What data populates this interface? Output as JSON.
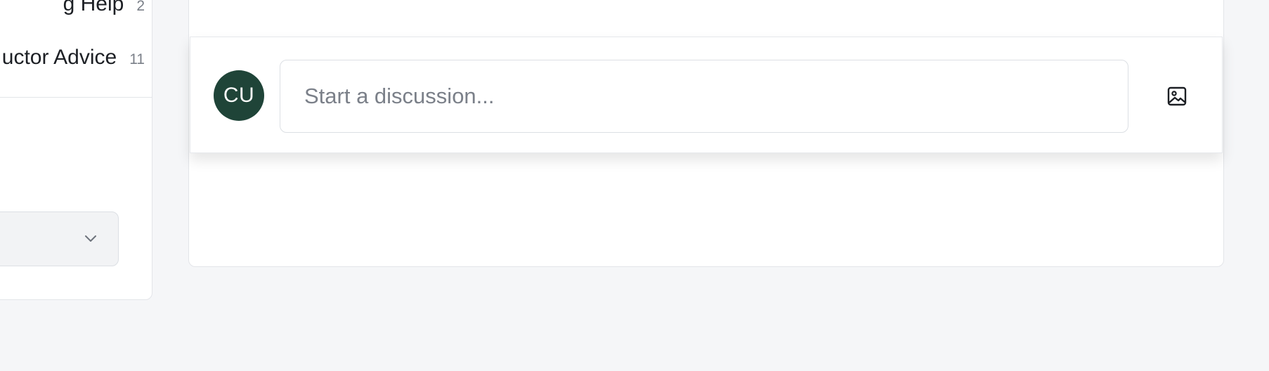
{
  "sidebar": {
    "categories": [
      {
        "label": "g Help",
        "count": "2"
      },
      {
        "label": "uctor Advice",
        "count": "11"
      }
    ],
    "select": {
      "icon": "chevron-down-icon"
    }
  },
  "composer": {
    "avatar_initials": "CU",
    "avatar_color": "#1f4438",
    "input_placeholder": "Start a discussion...",
    "input_value": "",
    "image_button_icon": "image-icon"
  }
}
